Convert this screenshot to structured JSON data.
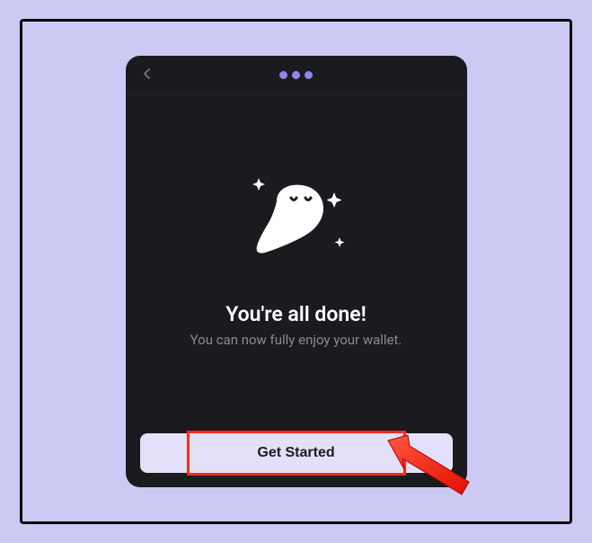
{
  "header": {
    "back_icon": "back"
  },
  "content": {
    "illustration": "ghost-with-sparkles",
    "title": "You're all done!",
    "subtitle": "You can now fully enjoy your wallet."
  },
  "footer": {
    "primary_button_label": "Get Started"
  },
  "annotation": {
    "highlight_target": "get-started-button",
    "arrow_color": "#ff2a1a"
  },
  "colors": {
    "page_bg": "#cdc9f5",
    "window_bg": "#1a1a1f",
    "accent": "#8b87e8",
    "button_bg": "#e3e1f9",
    "text_primary": "#ffffff",
    "text_secondary": "#8a8a92"
  }
}
